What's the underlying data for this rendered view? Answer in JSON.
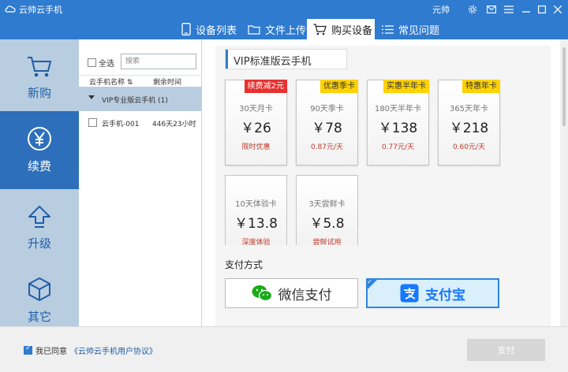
{
  "window": {
    "title": "云帅云手机",
    "user": "元帅",
    "controls": [
      "settings-icon",
      "mail-icon",
      "menu-icon",
      "minimize-icon",
      "maximize-icon",
      "close-icon"
    ]
  },
  "tabs": [
    {
      "label": "设备列表",
      "icon": "phone-icon",
      "active": false
    },
    {
      "label": "文件上传",
      "icon": "folder-icon",
      "active": false
    },
    {
      "label": "购买设备",
      "icon": "cart-icon",
      "active": true
    },
    {
      "label": "常见问题",
      "icon": "list-icon",
      "active": false
    }
  ],
  "sidebar": {
    "items": [
      {
        "label": "新购",
        "icon": "cart-icon",
        "active": false
      },
      {
        "label": "续费",
        "icon": "yen-icon",
        "active": true
      },
      {
        "label": "升级",
        "icon": "upgrade-icon",
        "active": false
      },
      {
        "label": "其它",
        "icon": "cube-icon",
        "active": false
      }
    ]
  },
  "devices": {
    "select_all_label": "全选",
    "search_placeholder": "搜索",
    "columns": [
      "云手机名称",
      "剩余时间"
    ],
    "group_label": "VIP专业版云手机 (1)",
    "items": [
      {
        "name": "云手机-001",
        "remaining": "446天23小时"
      }
    ]
  },
  "plan": {
    "header": "VIP标准版云手机",
    "cards": [
      {
        "badge": "续费减2元",
        "badge_color": "#e8312f",
        "badge_text_color": "#ffffff",
        "name": "30天月卡",
        "price": "￥26",
        "sub": "限时优惠"
      },
      {
        "badge": "优惠季卡",
        "badge_color": "#ffd200",
        "badge_text_color": "#333333",
        "name": "90天季卡",
        "price": "￥78",
        "sub": "0.87元/天"
      },
      {
        "badge": "实惠半年卡",
        "badge_color": "#ffd200",
        "badge_text_color": "#333333",
        "name": "180天半年卡",
        "price": "￥138",
        "sub": "0.77元/天"
      },
      {
        "badge": "特惠年卡",
        "badge_color": "#ffd200",
        "badge_text_color": "#333333",
        "name": "365天年卡",
        "price": "￥218",
        "sub": "0.60元/天"
      },
      {
        "badge": "",
        "name": "10天体验卡",
        "price": "￥13.8",
        "sub": "深度体验"
      },
      {
        "badge": "",
        "name": "3天尝鲜卡",
        "price": "￥5.8",
        "sub": "尝鲜试用"
      }
    ]
  },
  "payment": {
    "title": "支付方式",
    "options": [
      {
        "label": "微信支付",
        "icon": "wechat-icon",
        "selected": false
      },
      {
        "label": "支付宝",
        "icon": "alipay-icon",
        "selected": true
      }
    ]
  },
  "footer": {
    "agree_label": "我已同意",
    "agreement_link": "《云帅云手机用户协议》",
    "pay_label": "支付"
  },
  "colors": {
    "accent": "#2f7bd0",
    "sidebar_active": "#2d6fba",
    "wechat": "#1aad19",
    "alipay": "#1677ff"
  }
}
